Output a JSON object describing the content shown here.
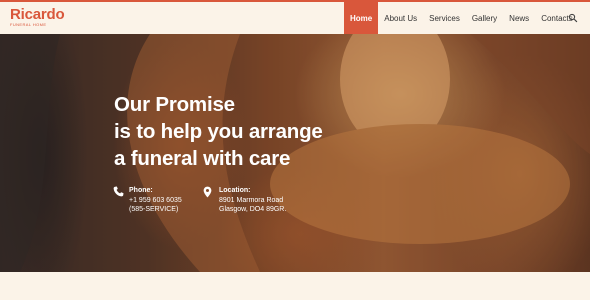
{
  "colors": {
    "accent": "#d9573b",
    "background": "#fbf3e8",
    "text": "#333333"
  },
  "logo": {
    "title": "Ricardo",
    "subtitle": "FUNERAL HOME"
  },
  "nav": {
    "items": [
      {
        "label": "Home",
        "active": true
      },
      {
        "label": "About Us"
      },
      {
        "label": "Services"
      },
      {
        "label": "Gallery"
      },
      {
        "label": "News"
      },
      {
        "label": "Contacts"
      }
    ],
    "search_icon": "search-icon"
  },
  "hero": {
    "title_lines": [
      "Our Promise",
      "is to help you arrange",
      "a funeral with care"
    ],
    "phone": {
      "icon": "phone-icon",
      "label": "Phone:",
      "lines": [
        "+1 959 603 6035",
        "(585-SERVICE)"
      ]
    },
    "location": {
      "icon": "map-pin-icon",
      "label": "Location:",
      "lines": [
        "8901 Marmora Road",
        "Glasgow, DO4 89GR."
      ]
    }
  }
}
